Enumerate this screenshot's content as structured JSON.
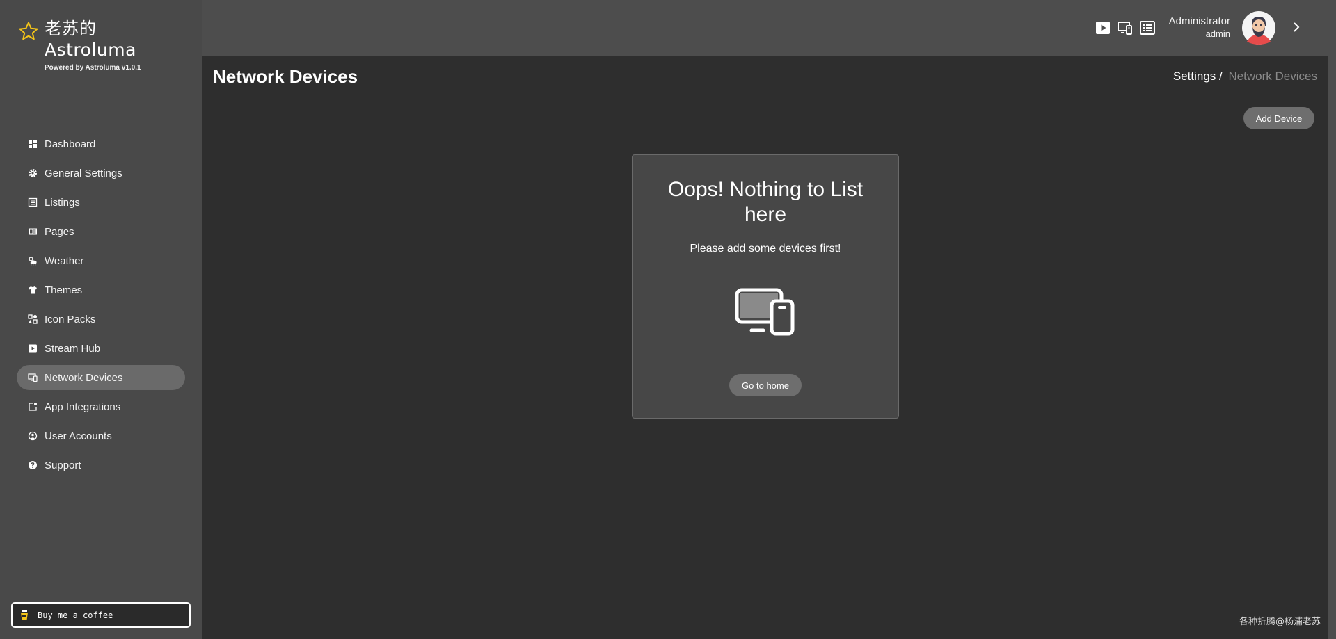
{
  "brand": {
    "cn_name": "老苏的",
    "name": "Astroluma",
    "powered": "Powered by Astroluma v1.0.1",
    "accent": "#f5c518"
  },
  "sidebar": {
    "items": [
      {
        "label": "Dashboard",
        "icon": "dashboard-icon"
      },
      {
        "label": "General Settings",
        "icon": "gear-icon"
      },
      {
        "label": "Listings",
        "icon": "list-icon"
      },
      {
        "label": "Pages",
        "icon": "pages-icon"
      },
      {
        "label": "Weather",
        "icon": "weather-icon"
      },
      {
        "label": "Themes",
        "icon": "shirt-icon"
      },
      {
        "label": "Icon Packs",
        "icon": "icon-packs-icon"
      },
      {
        "label": "Stream Hub",
        "icon": "play-icon"
      },
      {
        "label": "Network Devices",
        "icon": "network-devices-icon",
        "active": true
      },
      {
        "label": "App Integrations",
        "icon": "integration-icon"
      },
      {
        "label": "User Accounts",
        "icon": "user-accounts-icon"
      },
      {
        "label": "Support",
        "icon": "question-icon"
      }
    ],
    "coffee_label": "Buy me a coffee"
  },
  "header": {
    "icons": [
      "play-icon",
      "devices-icon",
      "list-icon"
    ],
    "user_name": "Administrator",
    "user_role": "admin"
  },
  "main": {
    "title": "Network Devices",
    "breadcrumb": {
      "parent": "Settings /",
      "current": "Network Devices"
    },
    "add_button": "Add Device",
    "empty": {
      "title": "Oops! Nothing to List here",
      "subtitle": "Please add some devices first!",
      "icon": "devices-icon",
      "button": "Go to home"
    }
  },
  "watermark": "各种折腾@杨浦老苏"
}
